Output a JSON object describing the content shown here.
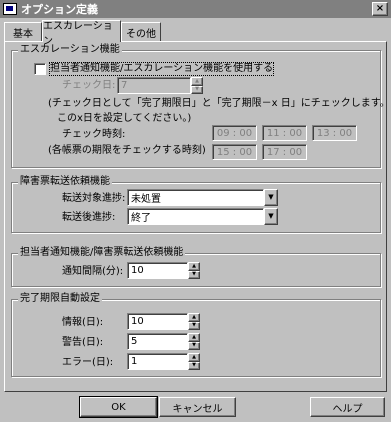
{
  "window": {
    "title": "オプション定義",
    "close_glyph": "×"
  },
  "tabs": [
    "基本",
    "エスカレーション",
    "その他"
  ],
  "escalation": {
    "legend": "エスカレーション機能",
    "checkbox_label": "担当者通知機能/エスカレーション機能を使用する",
    "check_day_label": "チェック日:",
    "check_day_value": "7",
    "note_line1": "(チェック日として「完了期限日」と「完了期限－x 日」にチェックします。",
    "note_line2": "このx日を設定してください。)",
    "check_time_label": "チェック時刻:",
    "check_time_note": "(各帳票の期限をチェックする時刻)",
    "times": [
      "09 : 00",
      "11 : 00",
      "13 : 00",
      "15 : 00",
      "17 : 00"
    ]
  },
  "transfer": {
    "legend": "障害票転送依頼機能",
    "target_label": "転送対象進捗:",
    "target_value": "未処置",
    "after_label": "転送後進捗:",
    "after_value": "終了"
  },
  "notify": {
    "legend": "担当者通知機能/障害票転送依頼機能",
    "interval_label": "通知間隔(分):",
    "interval_value": "10"
  },
  "deadline": {
    "legend": "完了期限自動設定",
    "info_label": "情報(日):",
    "info_value": "10",
    "warn_label": "警告(日):",
    "warn_value": "5",
    "error_label": "エラー(日):",
    "error_value": "1"
  },
  "buttons": {
    "ok": "OK",
    "cancel": "キャンセル",
    "help": "ヘルプ"
  },
  "icons": {
    "spin_up": "▲",
    "spin_down": "▼",
    "combo": "▼"
  }
}
